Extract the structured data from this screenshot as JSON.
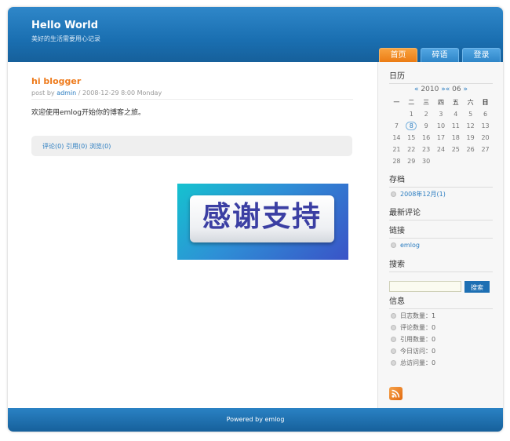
{
  "header": {
    "title": "Hello World",
    "subtitle": "美好的生活需要用心记录"
  },
  "nav": {
    "tabs": [
      {
        "label": "首页",
        "active": true
      },
      {
        "label": "碎语",
        "active": false
      },
      {
        "label": "登录",
        "active": false
      }
    ]
  },
  "post": {
    "title": "hi blogger",
    "meta_prefix": "post by ",
    "author": "admin",
    "meta_suffix": " / 2008-12-29 8:00 Monday",
    "body": "欢迎使用emlog开始你的博客之旅。",
    "comments": "评论(0)",
    "trackbacks": "引用(0)",
    "views": "浏览(0)"
  },
  "banner": {
    "text": "感谢支持"
  },
  "sidebar": {
    "calendar": {
      "heading": "日历",
      "prev_year": "«",
      "year": "2010",
      "next_year": "»",
      "prev_month": "«",
      "month": "06",
      "next_month": "»",
      "weekdays": [
        "一",
        "二",
        "三",
        "四",
        "五",
        "六",
        "日"
      ],
      "weeks": [
        [
          "",
          "1",
          "2",
          "3",
          "4",
          "5",
          "6"
        ],
        [
          "7",
          "8",
          "9",
          "10",
          "11",
          "12",
          "13"
        ],
        [
          "14",
          "15",
          "16",
          "17",
          "18",
          "19",
          "20"
        ],
        [
          "21",
          "22",
          "23",
          "24",
          "25",
          "26",
          "27"
        ],
        [
          "28",
          "29",
          "30",
          "",
          "",
          "",
          ""
        ]
      ],
      "today": "8"
    },
    "archive": {
      "heading": "存档",
      "items": [
        "2008年12月(1)"
      ]
    },
    "recent_comments": {
      "heading": "最新评论"
    },
    "links": {
      "heading": "链接",
      "items": [
        "emlog"
      ]
    },
    "search": {
      "heading": "搜索",
      "placeholder": "",
      "button": "搜索"
    },
    "info": {
      "heading": "信息",
      "items": [
        "日志数量：1",
        "评论数量：0",
        "引用数量：0",
        "今日访问：0",
        "总访问量：0"
      ]
    },
    "rss_icon": "rss-icon"
  },
  "footer": {
    "text": "Powered by emlog"
  },
  "colors": {
    "brand_blue": "#1a6fb1",
    "accent_orange": "#ee7b1c",
    "link_blue": "#2a7cc0"
  }
}
